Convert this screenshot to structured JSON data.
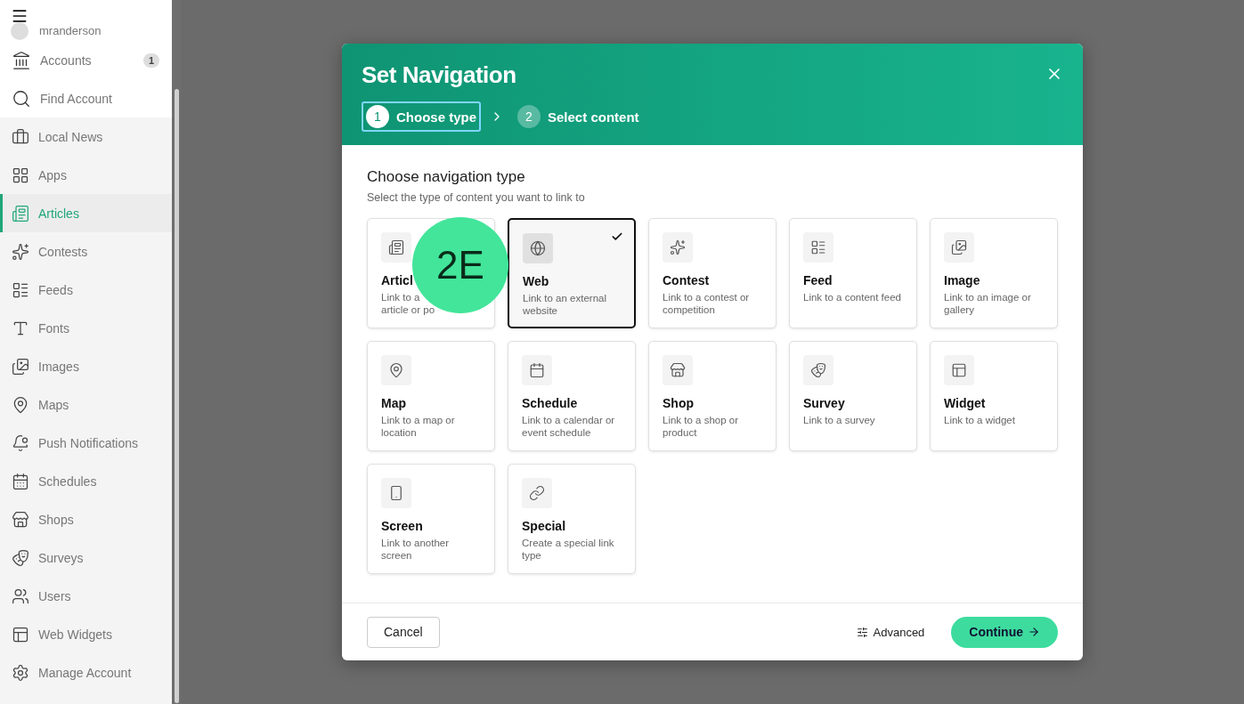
{
  "sidebar": {
    "user": "mranderson",
    "items": [
      {
        "label": "Accounts",
        "badge": "1",
        "selected": false
      },
      {
        "label": "Find Account",
        "selected": false
      },
      {
        "label": "Local News",
        "selected": false
      },
      {
        "label": "Apps",
        "selected": false
      },
      {
        "label": "Articles",
        "selected": true
      },
      {
        "label": "Contests",
        "selected": false
      },
      {
        "label": "Feeds",
        "selected": false
      },
      {
        "label": "Fonts",
        "selected": false
      },
      {
        "label": "Images",
        "selected": false
      },
      {
        "label": "Maps",
        "selected": false
      },
      {
        "label": "Push Notifications",
        "selected": false
      },
      {
        "label": "Schedules",
        "selected": false
      },
      {
        "label": "Shops",
        "selected": false
      },
      {
        "label": "Surveys",
        "selected": false
      },
      {
        "label": "Users",
        "selected": false
      },
      {
        "label": "Web Widgets",
        "selected": false
      },
      {
        "label": "Manage Account",
        "selected": false
      }
    ]
  },
  "dialog": {
    "title": "Set Navigation",
    "steps": [
      {
        "number": "1",
        "label": "Choose type",
        "selected": true
      },
      {
        "number": "2",
        "label": "Select content",
        "selected": false
      }
    ],
    "heading": "Choose navigation type",
    "subheading": "Select the type of content you want to link to",
    "types": [
      {
        "title": "Articl",
        "description": "Link to a\narticle or po",
        "selected": false
      },
      {
        "title": "Web",
        "description": "Link to an external website",
        "selected": true
      },
      {
        "title": "Contest",
        "description": "Link to a contest or competition",
        "selected": false
      },
      {
        "title": "Feed",
        "description": "Link to a content feed",
        "selected": false
      },
      {
        "title": "Image",
        "description": "Link to an image or gallery",
        "selected": false
      },
      {
        "title": "Map",
        "description": "Link to a map or location",
        "selected": false
      },
      {
        "title": "Schedule",
        "description": "Link to a calendar or event schedule",
        "selected": false
      },
      {
        "title": "Shop",
        "description": "Link to a shop or product",
        "selected": false
      },
      {
        "title": "Survey",
        "description": "Link to a survey",
        "selected": false
      },
      {
        "title": "Widget",
        "description": "Link to a widget",
        "selected": false
      },
      {
        "title": "Screen",
        "description": "Link to another screen",
        "selected": false
      },
      {
        "title": "Special",
        "description": "Create a special link type",
        "selected": false
      }
    ],
    "cancel": "Cancel",
    "advanced": "Advanced",
    "continue": "Continue"
  },
  "annotation": {
    "label": "2E"
  }
}
